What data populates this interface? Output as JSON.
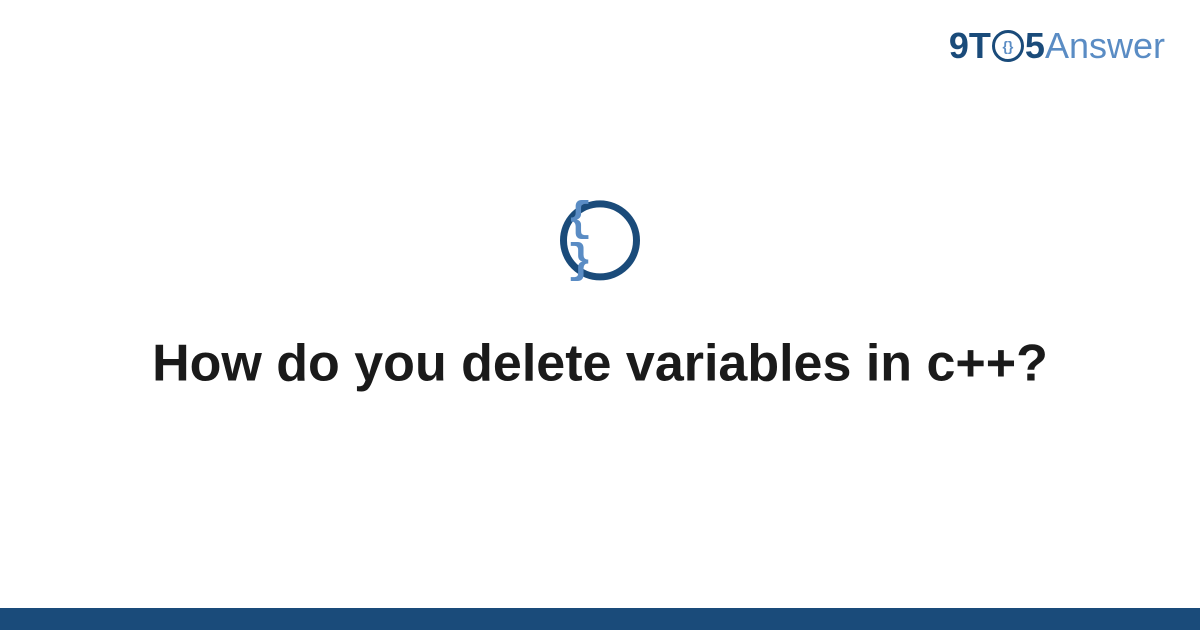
{
  "logo": {
    "part1": "9T",
    "inner": "{}",
    "part3": "5",
    "part4": "Answer"
  },
  "icon": {
    "braces": "{ }",
    "name": "code-braces-icon"
  },
  "title": "How do you delete variables in c++?",
  "colors": {
    "primary": "#1a4b7a",
    "accent": "#5a8cc4"
  }
}
